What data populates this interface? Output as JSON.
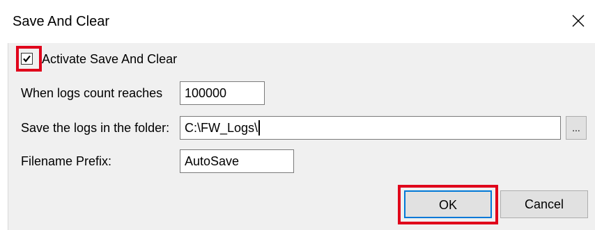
{
  "dialog": {
    "title": "Save And Clear",
    "close_icon": "close-icon"
  },
  "activate": {
    "label": "Activate Save And Clear",
    "checked": true
  },
  "fields": {
    "logs_count_label": "When logs count reaches",
    "logs_count_value": "100000",
    "folder_label": "Save the logs in the folder:",
    "folder_value": "C:\\FW_Logs\\",
    "browse_label": "...",
    "prefix_label": "Filename Prefix:",
    "prefix_value": "AutoSave"
  },
  "buttons": {
    "ok_label": "OK",
    "cancel_label": "Cancel"
  },
  "colors": {
    "highlight": "#e0001b",
    "focus": "#0078d7",
    "client_bg": "#f0f0f0"
  }
}
